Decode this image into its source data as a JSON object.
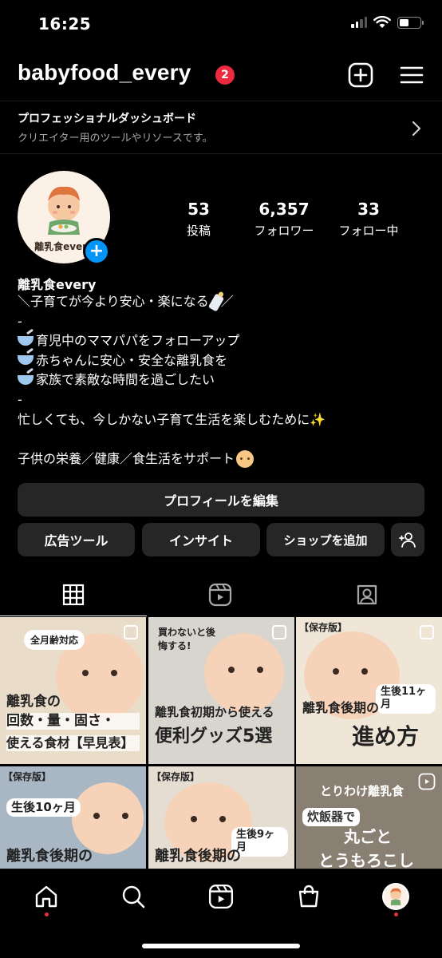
{
  "status_bar": {
    "time": "16:25"
  },
  "header": {
    "username": "babyfood_every",
    "notification_count": "2"
  },
  "dashboard": {
    "title": "プロフェッショナルダッシュボード",
    "subtitle": "クリエイター用のツールやリソースです。"
  },
  "profile": {
    "avatar_caption": "離乳食every",
    "stats": [
      {
        "value": "53",
        "label": "投稿"
      },
      {
        "value": "6,357",
        "label": "フォロワー"
      },
      {
        "value": "33",
        "label": "フォロー中"
      }
    ],
    "name": "離乳食every",
    "bio_lines": [
      "＼子育てが今より安心・楽になる",
      "／",
      "-",
      "育児中のママパパをフォローアップ",
      "赤ちゃんに安心・安全な離乳食を",
      "家族で素敵な時間を過ごしたい",
      "-",
      "忙しくても、今しかない子育て生活を楽しむために",
      "",
      "子供の栄養／健康／食生活をサポート"
    ]
  },
  "buttons": {
    "edit_profile": "プロフィールを編集",
    "ad_tools": "広告ツール",
    "insights": "インサイト",
    "add_shop": "ショップを追加"
  },
  "posts": [
    {
      "tag": "全月齢対応",
      "title_1": "離乳食の",
      "title_2": "回数・量・固さ・",
      "title_3": "使える食材【早見表】"
    },
    {
      "tag": "買わないと後悔する!",
      "title_1": "離乳食初期から使える",
      "title_2": "便利グッズ5選",
      "title_3": ""
    },
    {
      "tag": "【保存版】",
      "title_1": "生後11ヶ月",
      "title_2": "離乳食後期の",
      "title_3": "進め方"
    },
    {
      "tag": "【保存版】",
      "title_1": "生後10ヶ月",
      "title_2": "離乳食後期の",
      "title_3": ""
    },
    {
      "tag": "【保存版】",
      "title_1": "生後9ヶ月",
      "title_2": "離乳食後期の",
      "title_3": ""
    },
    {
      "tag": "とりわけ離乳食",
      "title_1": "炊飯器で",
      "title_2": "丸ごと",
      "title_3": "とうもろこし"
    }
  ],
  "colors": {
    "background": "#000000",
    "button_bg": "#262626",
    "badge": "#ed2a40",
    "accent_blue": "#0095f6",
    "muted_text": "#a8a8a8"
  },
  "icons": {
    "header": [
      "plus-square-icon",
      "hamburger-menu-icon"
    ],
    "tabs": [
      "grid-icon",
      "reels-icon",
      "tagged-icon"
    ],
    "nav": [
      "home-icon",
      "search-icon",
      "reels-icon",
      "shop-icon",
      "profile-avatar-icon"
    ]
  }
}
